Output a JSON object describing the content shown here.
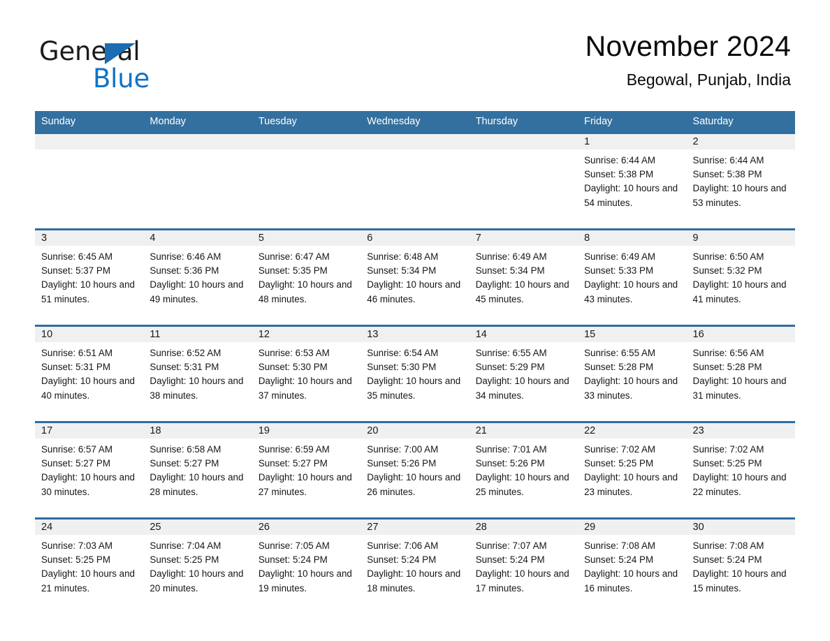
{
  "logo": {
    "word1": "General",
    "word2": "Blue",
    "triangle_icon": "blue-triangle-icon",
    "accent_color": "#1173c4"
  },
  "header": {
    "month_title": "November 2024",
    "location": "Begowal, Punjab, India"
  },
  "theme": {
    "header_row_bg": "#33709f",
    "row_divider": "#2e6da4",
    "daynum_bg": "#f0f0f0",
    "page_bg": "#ffffff",
    "text": "#161616"
  },
  "calendar": {
    "weekday_headers": [
      "Sunday",
      "Monday",
      "Tuesday",
      "Wednesday",
      "Thursday",
      "Friday",
      "Saturday"
    ],
    "labels": {
      "sunrise": "Sunrise:",
      "sunset": "Sunset:",
      "daylight": "Daylight:"
    },
    "weeks": [
      [
        {
          "day": "",
          "blank": true
        },
        {
          "day": "",
          "blank": true
        },
        {
          "day": "",
          "blank": true
        },
        {
          "day": "",
          "blank": true
        },
        {
          "day": "",
          "blank": true
        },
        {
          "day": "1",
          "sunrise": "Sunrise: 6:44 AM",
          "sunset": "Sunset: 5:38 PM",
          "daylight": "Daylight: 10 hours and 54 minutes."
        },
        {
          "day": "2",
          "sunrise": "Sunrise: 6:44 AM",
          "sunset": "Sunset: 5:38 PM",
          "daylight": "Daylight: 10 hours and 53 minutes."
        }
      ],
      [
        {
          "day": "3",
          "sunrise": "Sunrise: 6:45 AM",
          "sunset": "Sunset: 5:37 PM",
          "daylight": "Daylight: 10 hours and 51 minutes."
        },
        {
          "day": "4",
          "sunrise": "Sunrise: 6:46 AM",
          "sunset": "Sunset: 5:36 PM",
          "daylight": "Daylight: 10 hours and 49 minutes."
        },
        {
          "day": "5",
          "sunrise": "Sunrise: 6:47 AM",
          "sunset": "Sunset: 5:35 PM",
          "daylight": "Daylight: 10 hours and 48 minutes."
        },
        {
          "day": "6",
          "sunrise": "Sunrise: 6:48 AM",
          "sunset": "Sunset: 5:34 PM",
          "daylight": "Daylight: 10 hours and 46 minutes."
        },
        {
          "day": "7",
          "sunrise": "Sunrise: 6:49 AM",
          "sunset": "Sunset: 5:34 PM",
          "daylight": "Daylight: 10 hours and 45 minutes."
        },
        {
          "day": "8",
          "sunrise": "Sunrise: 6:49 AM",
          "sunset": "Sunset: 5:33 PM",
          "daylight": "Daylight: 10 hours and 43 minutes."
        },
        {
          "day": "9",
          "sunrise": "Sunrise: 6:50 AM",
          "sunset": "Sunset: 5:32 PM",
          "daylight": "Daylight: 10 hours and 41 minutes."
        }
      ],
      [
        {
          "day": "10",
          "sunrise": "Sunrise: 6:51 AM",
          "sunset": "Sunset: 5:31 PM",
          "daylight": "Daylight: 10 hours and 40 minutes."
        },
        {
          "day": "11",
          "sunrise": "Sunrise: 6:52 AM",
          "sunset": "Sunset: 5:31 PM",
          "daylight": "Daylight: 10 hours and 38 minutes."
        },
        {
          "day": "12",
          "sunrise": "Sunrise: 6:53 AM",
          "sunset": "Sunset: 5:30 PM",
          "daylight": "Daylight: 10 hours and 37 minutes."
        },
        {
          "day": "13",
          "sunrise": "Sunrise: 6:54 AM",
          "sunset": "Sunset: 5:30 PM",
          "daylight": "Daylight: 10 hours and 35 minutes."
        },
        {
          "day": "14",
          "sunrise": "Sunrise: 6:55 AM",
          "sunset": "Sunset: 5:29 PM",
          "daylight": "Daylight: 10 hours and 34 minutes."
        },
        {
          "day": "15",
          "sunrise": "Sunrise: 6:55 AM",
          "sunset": "Sunset: 5:28 PM",
          "daylight": "Daylight: 10 hours and 33 minutes."
        },
        {
          "day": "16",
          "sunrise": "Sunrise: 6:56 AM",
          "sunset": "Sunset: 5:28 PM",
          "daylight": "Daylight: 10 hours and 31 minutes."
        }
      ],
      [
        {
          "day": "17",
          "sunrise": "Sunrise: 6:57 AM",
          "sunset": "Sunset: 5:27 PM",
          "daylight": "Daylight: 10 hours and 30 minutes."
        },
        {
          "day": "18",
          "sunrise": "Sunrise: 6:58 AM",
          "sunset": "Sunset: 5:27 PM",
          "daylight": "Daylight: 10 hours and 28 minutes."
        },
        {
          "day": "19",
          "sunrise": "Sunrise: 6:59 AM",
          "sunset": "Sunset: 5:27 PM",
          "daylight": "Daylight: 10 hours and 27 minutes."
        },
        {
          "day": "20",
          "sunrise": "Sunrise: 7:00 AM",
          "sunset": "Sunset: 5:26 PM",
          "daylight": "Daylight: 10 hours and 26 minutes."
        },
        {
          "day": "21",
          "sunrise": "Sunrise: 7:01 AM",
          "sunset": "Sunset: 5:26 PM",
          "daylight": "Daylight: 10 hours and 25 minutes."
        },
        {
          "day": "22",
          "sunrise": "Sunrise: 7:02 AM",
          "sunset": "Sunset: 5:25 PM",
          "daylight": "Daylight: 10 hours and 23 minutes."
        },
        {
          "day": "23",
          "sunrise": "Sunrise: 7:02 AM",
          "sunset": "Sunset: 5:25 PM",
          "daylight": "Daylight: 10 hours and 22 minutes."
        }
      ],
      [
        {
          "day": "24",
          "sunrise": "Sunrise: 7:03 AM",
          "sunset": "Sunset: 5:25 PM",
          "daylight": "Daylight: 10 hours and 21 minutes."
        },
        {
          "day": "25",
          "sunrise": "Sunrise: 7:04 AM",
          "sunset": "Sunset: 5:25 PM",
          "daylight": "Daylight: 10 hours and 20 minutes."
        },
        {
          "day": "26",
          "sunrise": "Sunrise: 7:05 AM",
          "sunset": "Sunset: 5:24 PM",
          "daylight": "Daylight: 10 hours and 19 minutes."
        },
        {
          "day": "27",
          "sunrise": "Sunrise: 7:06 AM",
          "sunset": "Sunset: 5:24 PM",
          "daylight": "Daylight: 10 hours and 18 minutes."
        },
        {
          "day": "28",
          "sunrise": "Sunrise: 7:07 AM",
          "sunset": "Sunset: 5:24 PM",
          "daylight": "Daylight: 10 hours and 17 minutes."
        },
        {
          "day": "29",
          "sunrise": "Sunrise: 7:08 AM",
          "sunset": "Sunset: 5:24 PM",
          "daylight": "Daylight: 10 hours and 16 minutes."
        },
        {
          "day": "30",
          "sunrise": "Sunrise: 7:08 AM",
          "sunset": "Sunset: 5:24 PM",
          "daylight": "Daylight: 10 hours and 15 minutes."
        }
      ]
    ]
  }
}
